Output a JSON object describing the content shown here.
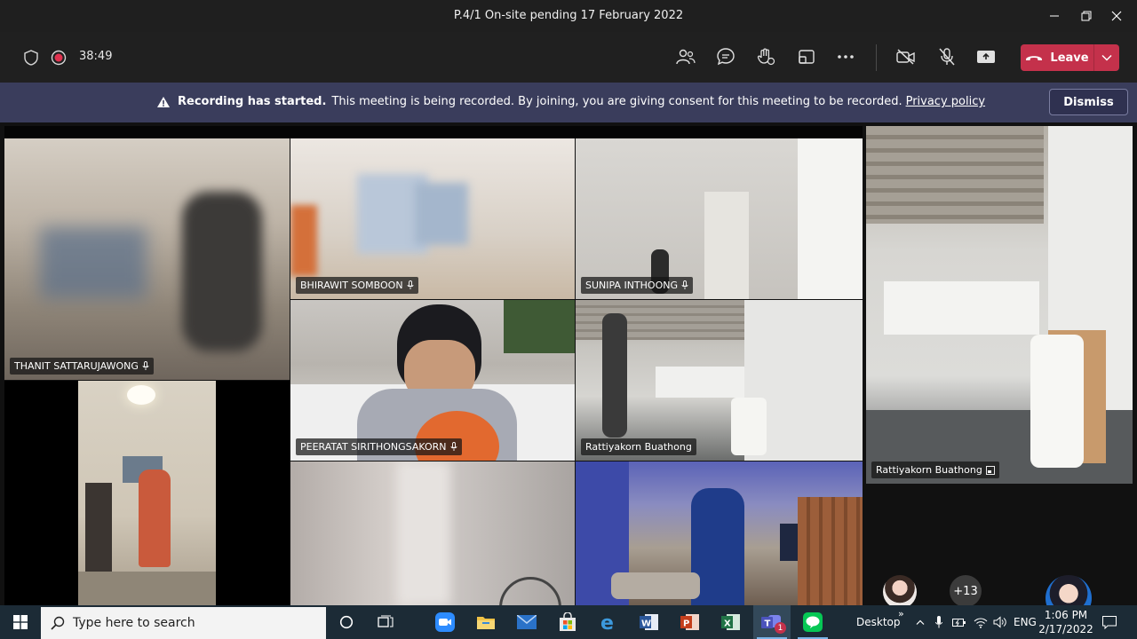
{
  "window": {
    "title": "P.4/1 On-site pending 17 February 2022"
  },
  "meeting": {
    "elapsed": "38:49",
    "leave_label": "Leave",
    "colors": {
      "leave": "#c4314b",
      "banner": "#3a3d5c",
      "toolbar": "#202020"
    }
  },
  "banner": {
    "strong": "Recording has started.",
    "message": "This meeting is being recorded. By joining, you are giving consent for this meeting to be recorded.",
    "link": "Privacy policy",
    "dismiss": "Dismiss"
  },
  "participants": [
    {
      "name": "THANIT SATTARUJAWONG"
    },
    {
      "name": "BHIRAWIT SOMBOON"
    },
    {
      "name": "SUNIPA INTHOONG"
    },
    {
      "name": "PEERATAT SIRITHONGSAKORN"
    },
    {
      "name": "Rattiyakorn Buathong"
    },
    {
      "name": "Rattiyakorn Buathong"
    }
  ],
  "roster": {
    "overflow": "+13"
  },
  "taskbar": {
    "search_placeholder": "Type here to search",
    "desktop_label": "Desktop",
    "overflow": "»",
    "language": "ENG",
    "time": "1:06 PM",
    "date": "2/17/2022",
    "teams_badge": "1",
    "apps": [
      "start-icon",
      "search-icon",
      "cortana-icon",
      "task-view-icon",
      "zoom-icon",
      "file-explorer-icon",
      "mail-icon",
      "store-icon",
      "edge-icon",
      "word-icon",
      "powerpoint-icon",
      "excel-icon",
      "teams-icon",
      "line-icon"
    ]
  }
}
